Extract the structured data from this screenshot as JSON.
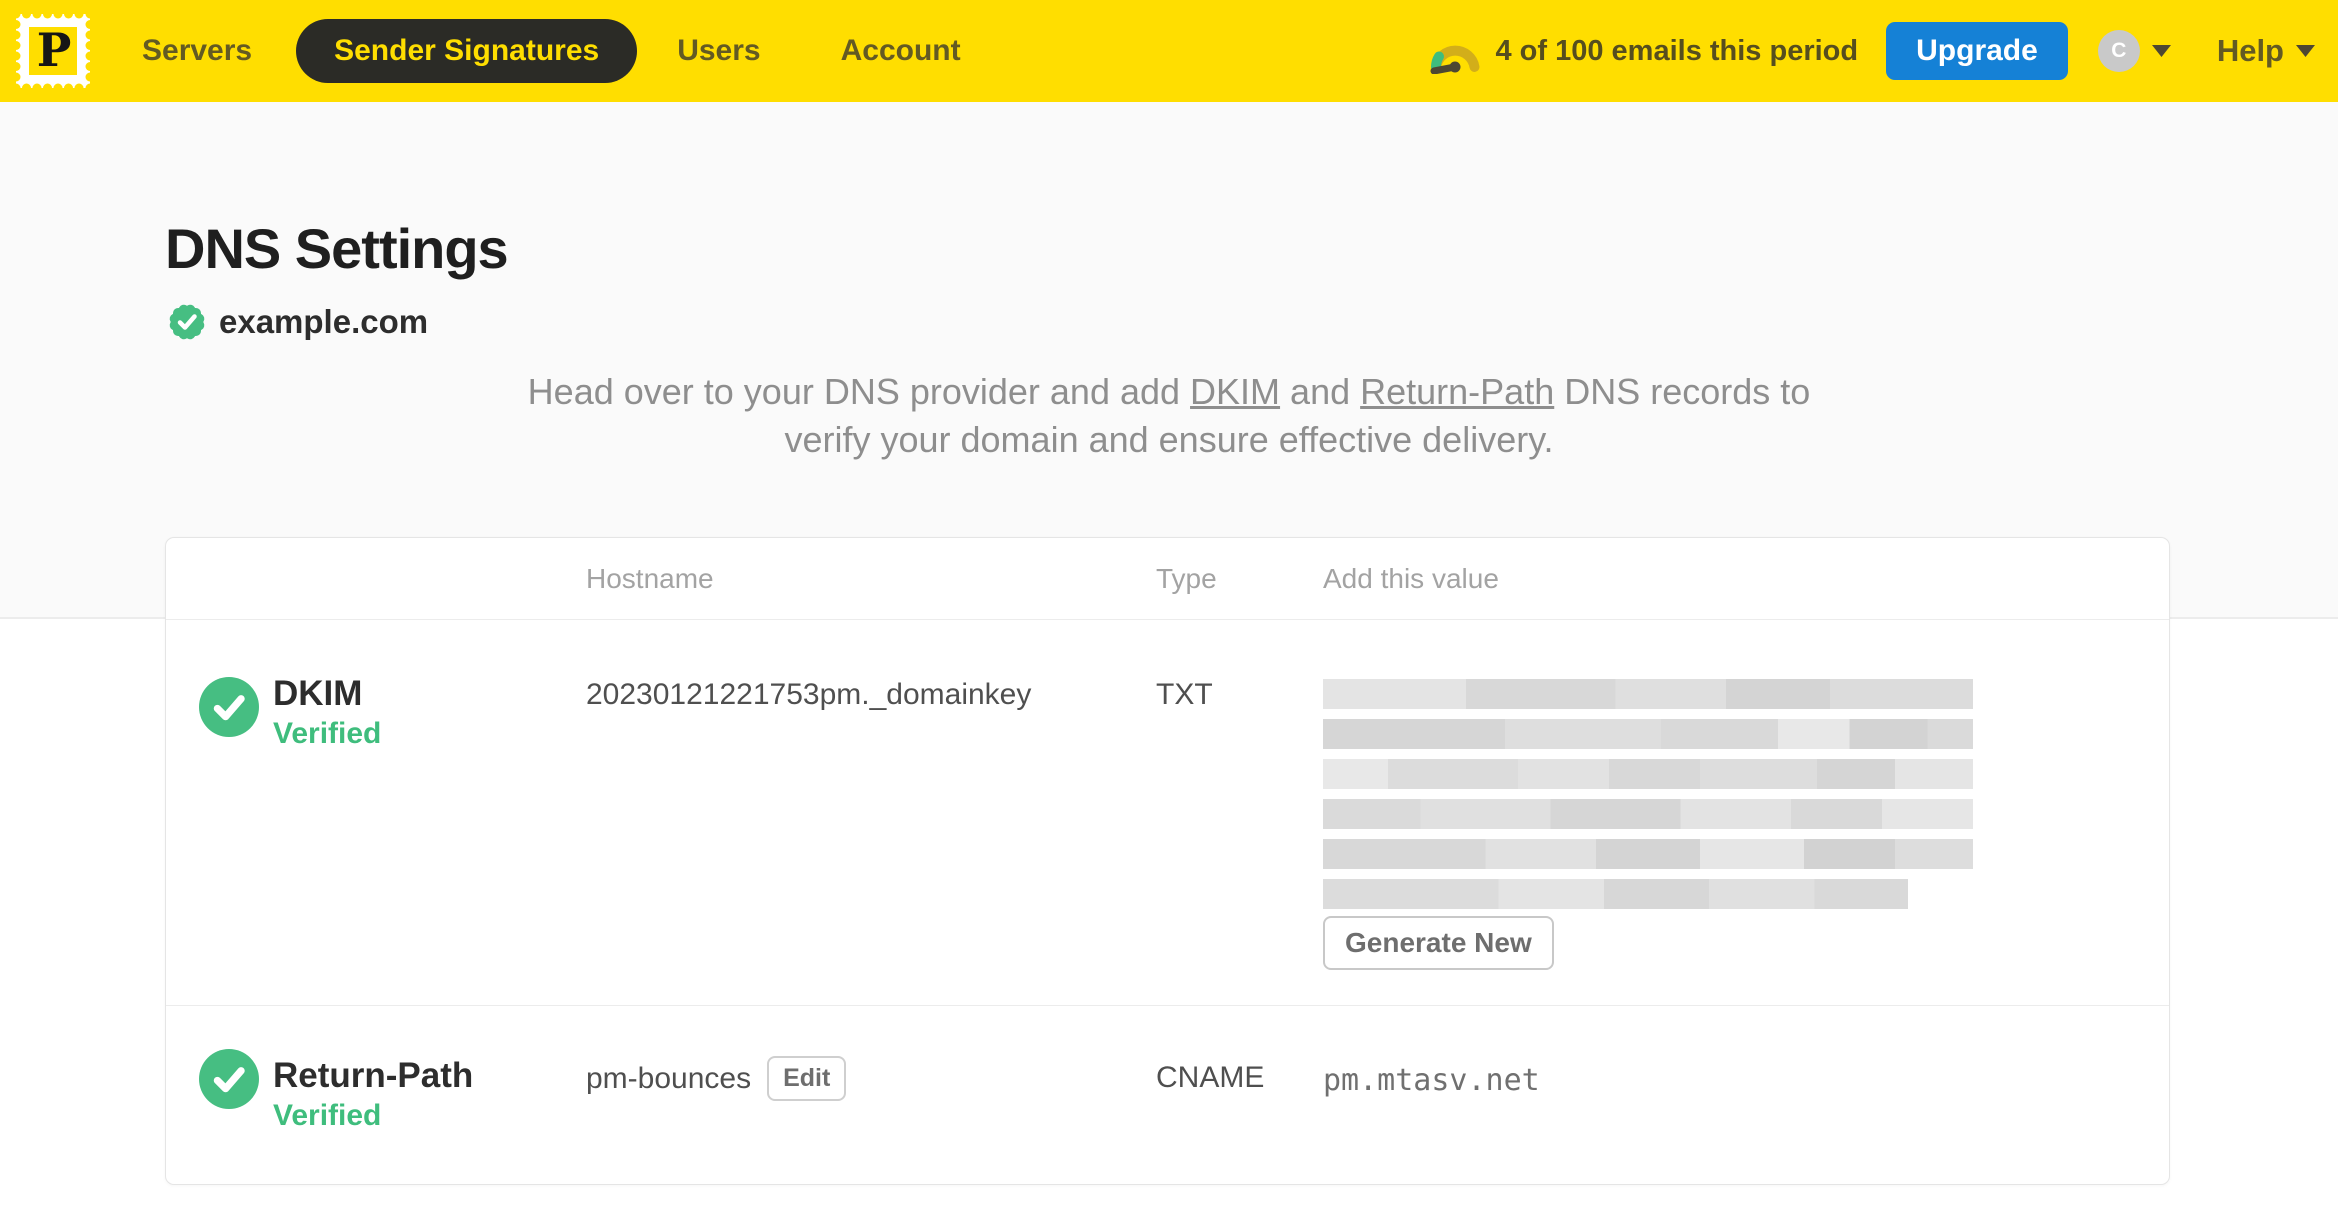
{
  "nav": {
    "logo_letter": "P",
    "items": [
      {
        "label": "Servers",
        "active": false
      },
      {
        "label": "Sender Signatures",
        "active": true
      },
      {
        "label": "Users",
        "active": false
      },
      {
        "label": "Account",
        "active": false
      }
    ],
    "usage_text": "4 of 100 emails this period",
    "upgrade_label": "Upgrade",
    "avatar_initial": "C",
    "help_label": "Help"
  },
  "page": {
    "title": "DNS Settings",
    "domain": "example.com",
    "domain_verified": true,
    "description": {
      "part1": "Head over to your DNS provider and add ",
      "link_dkim": "DKIM",
      "part2": " and ",
      "link_return_path": "Return-Path",
      "part3": " DNS records to verify your domain and ensure effective delivery."
    }
  },
  "table": {
    "headers": {
      "hostname": "Hostname",
      "type": "Type",
      "value": "Add this value"
    },
    "rows": [
      {
        "name": "DKIM",
        "status": "Verified",
        "hostname": "20230121221753pm._domainkey",
        "type": "TXT",
        "value_redacted": true,
        "action_label": "Generate New"
      },
      {
        "name": "Return-Path",
        "status": "Verified",
        "hostname": "pm-bounces",
        "edit_label": "Edit",
        "type": "CNAME",
        "value": "pm.mtasv.net"
      }
    ]
  },
  "colors": {
    "navbar_yellow": "#FFDE00",
    "nav_pill_dark": "#2B2B26",
    "upgrade_blue": "#1581D6",
    "success_green": "#3FBD7D",
    "hero_background": "#FAFAFA"
  }
}
